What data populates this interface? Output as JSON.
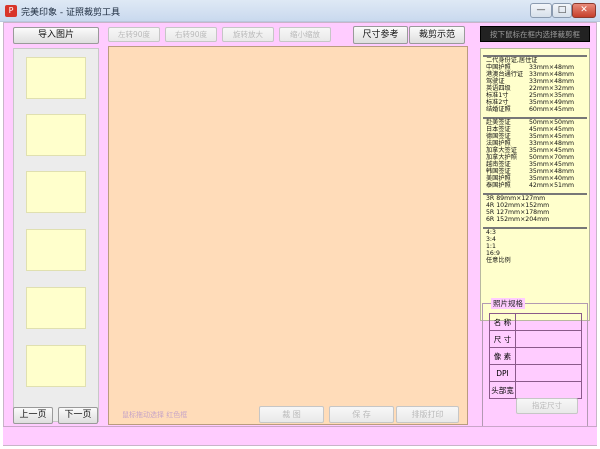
{
  "window": {
    "title": "完美印象 - 证照裁剪工具",
    "minimize_glyph": "—",
    "maximize_glyph": "□",
    "close_glyph": "✕"
  },
  "left": {
    "import_label": "导入图片",
    "prev_label": "上一页",
    "next_label": "下一页",
    "thumbnail_count": 6
  },
  "toolbar": {
    "tools": [
      "左转90度",
      "右转90度",
      "旋转放大",
      "缩小缩放"
    ],
    "size_ref_label": "尺寸参考",
    "crop_demo_label": "裁剪示范"
  },
  "bottom": {
    "status_text": "鼠标拖动选择 红色框",
    "crop_label": "裁 图",
    "save_label": "保 存",
    "layout_print_label": "排版打印"
  },
  "right": {
    "hint": "按下鼠标在框内选择裁剪框",
    "groups": [
      [
        {
          "name": "二代身份证,居住证",
          "size": ""
        },
        {
          "name": "中国护照",
          "size": "33mm×48mm"
        },
        {
          "name": "港澳台通行证",
          "size": "33mm×48mm"
        },
        {
          "name": "驾驶证",
          "size": "33mm×48mm"
        },
        {
          "name": "英语四级",
          "size": "22mm×32mm"
        },
        {
          "name": "标准1寸",
          "size": "25mm×35mm"
        },
        {
          "name": "标准2寸",
          "size": "35mm×49mm"
        },
        {
          "name": "结婚证照",
          "size": "60mm×45mm"
        }
      ],
      [
        {
          "name": "赴美签证",
          "size": "50mm×50mm"
        },
        {
          "name": "日本签证",
          "size": "45mm×45mm"
        },
        {
          "name": "德国签证",
          "size": "35mm×45mm"
        },
        {
          "name": "法国护照",
          "size": "33mm×48mm"
        },
        {
          "name": "加拿大签证",
          "size": "35mm×45mm"
        },
        {
          "name": "加拿大护照",
          "size": "50mm×70mm"
        },
        {
          "name": "越南签证",
          "size": "35mm×45mm"
        },
        {
          "name": "韩国签证",
          "size": "35mm×48mm"
        },
        {
          "name": "美国护照",
          "size": "35mm×40mm"
        },
        {
          "name": "泰国护照",
          "size": "42mm×51mm"
        }
      ],
      [
        {
          "name": "3R",
          "size": "89mm×127mm"
        },
        {
          "name": "4R",
          "size": "102mm×152mm"
        },
        {
          "name": "5R",
          "size": "127mm×178mm"
        },
        {
          "name": "6R",
          "size": "152mm×204mm"
        }
      ],
      [
        {
          "name": "4:3",
          "size": ""
        },
        {
          "name": "3:4",
          "size": ""
        },
        {
          "name": "1:1",
          "size": ""
        },
        {
          "name": "16:9",
          "size": ""
        },
        {
          "name": "任意比例",
          "size": ""
        }
      ]
    ],
    "spec": {
      "title": "照片规格",
      "rows": [
        {
          "label": "名 称",
          "value": ""
        },
        {
          "label": "尺 寸",
          "value": ""
        },
        {
          "label": "像 素",
          "value": ""
        },
        {
          "label": "DPI",
          "value": ""
        },
        {
          "label": "头部宽",
          "value": ""
        }
      ],
      "button_label": "指定尺寸"
    }
  }
}
